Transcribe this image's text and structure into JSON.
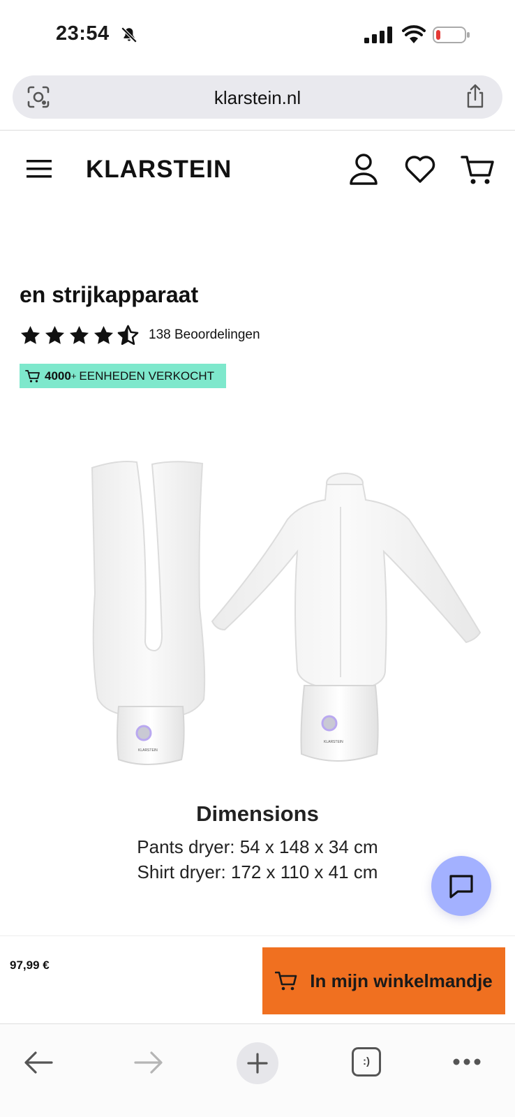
{
  "status_bar": {
    "time": "23:54",
    "icons": [
      "bell-slash-icon",
      "signal-icon",
      "wifi-icon",
      "battery-low-icon"
    ]
  },
  "browser": {
    "url": "klarstein.nl",
    "toolbar_icons": [
      "back-arrow-icon",
      "forward-arrow-icon",
      "plus-icon",
      "tabs-icon",
      "more-dots-icon"
    ],
    "tabs_label": ":)"
  },
  "header": {
    "brand": "KLARSTEIN",
    "icons": [
      "menu-icon",
      "user-icon",
      "heart-icon",
      "cart-icon"
    ]
  },
  "product": {
    "title": "en strijkapparaat",
    "rating": 4.5,
    "max_rating": 5,
    "reviews": "138 Beoordelingen",
    "sold_count": "4000",
    "sold_plus": "+",
    "sold_label": "EENHEDEN VERKOCHT",
    "image_logo_text": "KLARSTEIN",
    "dimensions": {
      "title": "Dimensions",
      "line1": "Pants dryer: 54 x 148 x 34 cm",
      "line2": "Shirt dryer:  172 x 110 x 41 cm"
    }
  },
  "buy_bar": {
    "price": "97,99 €",
    "button_label": "In mijn winkelmandje"
  },
  "colors": {
    "accent": "#f07020",
    "badge": "#7ee8cc",
    "chat": "#a3b1ff"
  }
}
